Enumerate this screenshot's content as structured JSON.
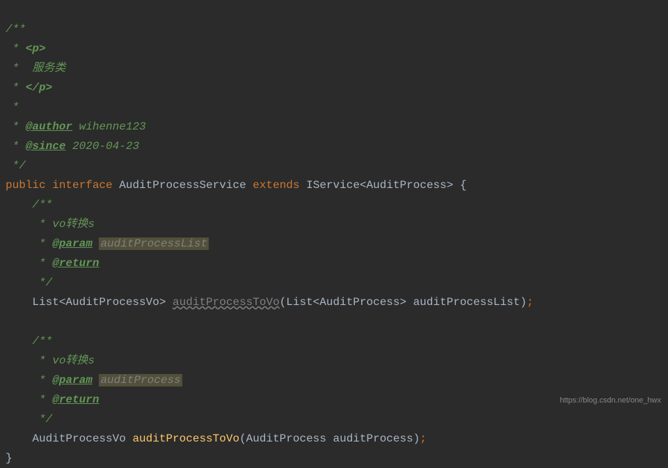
{
  "code": {
    "l1": "/**",
    "l2_pre": " * ",
    "l2_tag": "<p>",
    "l3_pre": " *  ",
    "l3_txt": "服务类",
    "l4_pre": " * ",
    "l4_tag": "</p>",
    "l5": " *",
    "l6_pre": " * ",
    "l6_tag": "@author",
    "l6_val": " wihenne123",
    "l7_pre": " * ",
    "l7_tag": "@since",
    "l7_val": " 2020-04-23",
    "l8": " */",
    "l9_kw1": "public",
    "l9_sp1": " ",
    "l9_kw2": "interface",
    "l9_sp2": " ",
    "l9_cls": "AuditProcessService",
    "l9_sp3": " ",
    "l9_kw3": "extends",
    "l9_sp4": " ",
    "l9_ext": "IService<AuditProcess> {",
    "l10_pre": "    ",
    "l10": "/**",
    "l11_pre": "     * ",
    "l11_txt": "vo转换s",
    "l12_pre": "     * ",
    "l12_tag": "@param",
    "l12_sp": " ",
    "l12_val": "auditProcessList",
    "l13_pre": "     * ",
    "l13_tag": "@return",
    "l14_pre": "     ",
    "l14": "*/",
    "l15_pre": "    ",
    "l15_ret": "List<AuditProcessVo> ",
    "l15_m": "auditProcessToVo",
    "l15_args": "(List<AuditProcess> auditProcessList)",
    "l15_semi": ";",
    "l16": "",
    "l17_pre": "    ",
    "l17": "/**",
    "l18_pre": "     * ",
    "l18_txt": "vo转换s",
    "l19_pre": "     * ",
    "l19_tag": "@param",
    "l19_sp": " ",
    "l19_val": "auditProcess",
    "l20_pre": "     * ",
    "l20_tag": "@return",
    "l21_pre": "     ",
    "l21": "*/",
    "l22_pre": "    ",
    "l22_ret": "AuditProcessVo ",
    "l22_m": "auditProcessToVo",
    "l22_args": "(AuditProcess auditProcess)",
    "l22_semi": ";",
    "l23": "}"
  },
  "watermark": "https://blog.csdn.net/one_hwx"
}
